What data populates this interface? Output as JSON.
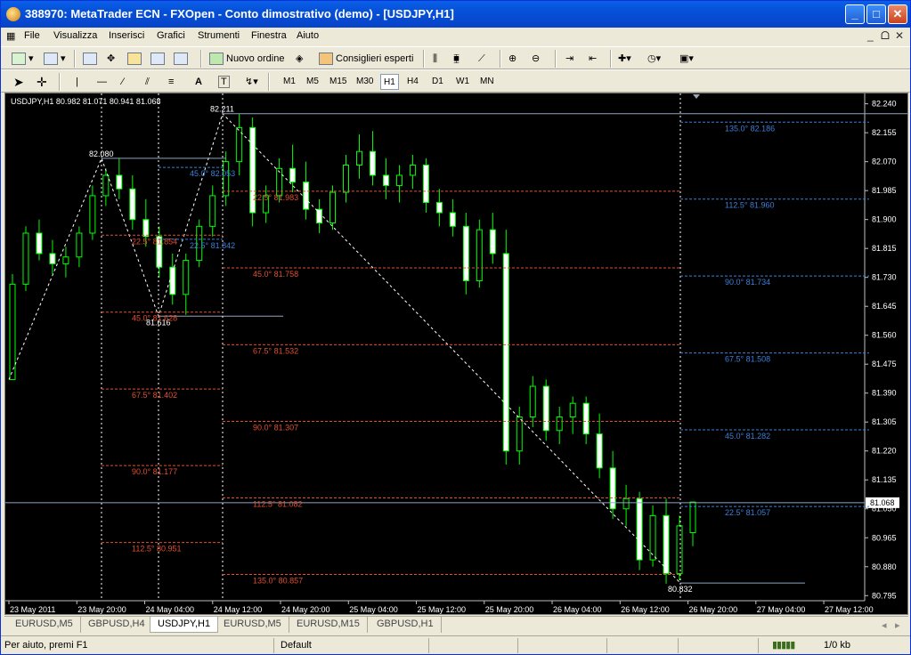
{
  "window": {
    "title": "388970: MetaTrader ECN - FXOpen - Conto dimostrativo (demo) - [USDJPY,H1]",
    "minimize": "_",
    "maximize": "□",
    "close": "✕"
  },
  "menu": [
    "File",
    "Visualizza",
    "Inserisci",
    "Grafici",
    "Strumenti",
    "Finestra",
    "Aiuto"
  ],
  "mdi": {
    "min": "_",
    "restore": "ᗝ",
    "close": "✕"
  },
  "toolbar1": {
    "new_order": "Nuovo ordine",
    "expert_advisors": "Consiglieri esperti"
  },
  "toolbar2": {
    "text_tool": "A",
    "label_tool": "T",
    "timeframes": [
      "M1",
      "M5",
      "M15",
      "M30",
      "H1",
      "H4",
      "D1",
      "W1",
      "MN"
    ],
    "active_timeframe": "H1"
  },
  "chart_data": {
    "type": "candlestick",
    "header": "USDJPY,H1  80.982 81.071 80.941 81.068",
    "price_scale": [
      "82.240",
      "82.155",
      "82.070",
      "81.985",
      "81.900",
      "81.815",
      "81.730",
      "81.645",
      "81.560",
      "81.475",
      "81.390",
      "81.305",
      "81.220",
      "81.135",
      "81.050",
      "80.965",
      "80.880",
      "80.795"
    ],
    "ylim": [
      80.78,
      82.26
    ],
    "current_price": "81.068",
    "time_labels": [
      "23 May 2011",
      "23 May 20:00",
      "24 May 04:00",
      "24 May 12:00",
      "24 May 20:00",
      "25 May 04:00",
      "25 May 12:00",
      "25 May 20:00",
      "26 May 04:00",
      "26 May 12:00",
      "26 May 20:00",
      "27 May 04:00",
      "27 May 12:00"
    ],
    "zigzag_points": [
      {
        "label": "82.080",
        "price": 82.08
      },
      {
        "label": "81.616",
        "price": 81.616
      },
      {
        "label": "82.211",
        "price": 82.211
      },
      {
        "label": "80.832",
        "price": 80.832
      }
    ],
    "gann_labels": [
      {
        "text": "45.0° 82.053",
        "price": 82.053,
        "color": "#3d7fd9"
      },
      {
        "text": "22.5° 81.842",
        "price": 81.842,
        "color": "#3d7fd9"
      },
      {
        "text": "22.5° 81.854",
        "price": 81.854,
        "color": "#e05030"
      },
      {
        "text": "45.0° 81.628",
        "price": 81.628,
        "color": "#e05030"
      },
      {
        "text": "67.5° 81.402",
        "price": 81.402,
        "color": "#e05030"
      },
      {
        "text": "90.0° 81.177",
        "price": 81.177,
        "color": "#e05030"
      },
      {
        "text": "112.5° 80.951",
        "price": 80.951,
        "color": "#e05030"
      },
      {
        "text": "22.5° 81.983",
        "price": 81.983,
        "color": "#e05030"
      },
      {
        "text": "45.0° 81.758",
        "price": 81.758,
        "color": "#e05030"
      },
      {
        "text": "67.5° 81.532",
        "price": 81.532,
        "color": "#e05030"
      },
      {
        "text": "90.0° 81.307",
        "price": 81.307,
        "color": "#e05030"
      },
      {
        "text": "112.5° 81.082",
        "price": 81.082,
        "color": "#e05030"
      },
      {
        "text": "135.0° 80.857",
        "price": 80.857,
        "color": "#e05030"
      },
      {
        "text": "135.0° 82.186",
        "price": 82.186,
        "color": "#3d7fd9"
      },
      {
        "text": "112.5° 81.960",
        "price": 81.96,
        "color": "#3d7fd9"
      },
      {
        "text": "90.0° 81.734",
        "price": 81.734,
        "color": "#3d7fd9"
      },
      {
        "text": "67.5° 81.508",
        "price": 81.508,
        "color": "#3d7fd9"
      },
      {
        "text": "45.0° 81.282",
        "price": 81.282,
        "color": "#3d7fd9"
      },
      {
        "text": "22.5° 81.057",
        "price": 81.057,
        "color": "#3d7fd9"
      }
    ],
    "candles": [
      [
        81.43,
        81.74,
        81.43,
        81.71
      ],
      [
        81.71,
        81.88,
        81.69,
        81.86
      ],
      [
        81.86,
        81.9,
        81.78,
        81.8
      ],
      [
        81.8,
        81.84,
        81.74,
        81.77
      ],
      [
        81.77,
        81.82,
        81.73,
        81.79
      ],
      [
        81.79,
        81.88,
        81.76,
        81.86
      ],
      [
        81.86,
        82.0,
        81.84,
        81.97
      ],
      [
        81.97,
        82.05,
        81.94,
        82.03
      ],
      [
        82.03,
        82.08,
        81.96,
        81.99
      ],
      [
        81.99,
        82.03,
        81.87,
        81.9
      ],
      [
        81.9,
        81.96,
        81.82,
        81.85
      ],
      [
        81.85,
        81.88,
        81.73,
        81.76
      ],
      [
        81.76,
        81.8,
        81.65,
        81.68
      ],
      [
        81.68,
        81.8,
        81.62,
        81.78
      ],
      [
        81.78,
        81.9,
        81.76,
        81.88
      ],
      [
        81.88,
        82.0,
        81.85,
        81.97
      ],
      [
        81.97,
        82.1,
        81.94,
        82.07
      ],
      [
        82.07,
        82.21,
        82.03,
        82.17
      ],
      [
        82.17,
        82.2,
        81.88,
        81.92
      ],
      [
        81.92,
        82.0,
        81.89,
        81.97
      ],
      [
        81.97,
        82.08,
        81.95,
        82.05
      ],
      [
        82.05,
        82.12,
        81.98,
        82.01
      ],
      [
        82.01,
        82.07,
        81.9,
        81.93
      ],
      [
        81.93,
        81.96,
        81.86,
        81.89
      ],
      [
        81.89,
        82.0,
        81.87,
        81.98
      ],
      [
        81.98,
        82.09,
        81.95,
        82.06
      ],
      [
        82.06,
        82.15,
        82.02,
        82.1
      ],
      [
        82.1,
        82.16,
        82.0,
        82.03
      ],
      [
        82.03,
        82.08,
        81.96,
        82.0
      ],
      [
        82.0,
        82.06,
        81.95,
        82.03
      ],
      [
        82.03,
        82.09,
        81.99,
        82.06
      ],
      [
        82.06,
        82.08,
        81.92,
        81.95
      ],
      [
        81.95,
        81.99,
        81.88,
        81.92
      ],
      [
        81.92,
        81.96,
        81.85,
        81.88
      ],
      [
        81.88,
        81.92,
        81.68,
        81.72
      ],
      [
        81.72,
        81.9,
        81.7,
        81.87
      ],
      [
        81.87,
        81.92,
        81.77,
        81.8
      ],
      [
        81.8,
        81.87,
        81.18,
        81.22
      ],
      [
        81.22,
        81.35,
        81.18,
        81.32
      ],
      [
        81.32,
        81.44,
        81.29,
        81.41
      ],
      [
        81.41,
        81.43,
        81.25,
        81.28
      ],
      [
        81.28,
        81.35,
        81.24,
        81.32
      ],
      [
        81.32,
        81.38,
        81.27,
        81.36
      ],
      [
        81.36,
        81.38,
        81.24,
        81.27
      ],
      [
        81.27,
        81.33,
        81.14,
        81.17
      ],
      [
        81.17,
        81.22,
        81.02,
        81.05
      ],
      [
        81.05,
        81.12,
        81.0,
        81.08
      ],
      [
        81.08,
        81.1,
        80.87,
        80.9
      ],
      [
        80.9,
        81.06,
        80.88,
        81.03
      ],
      [
        81.03,
        81.08,
        80.83,
        80.86
      ],
      [
        80.86,
        81.03,
        80.84,
        81.0
      ],
      [
        80.98,
        81.07,
        80.94,
        81.07
      ]
    ]
  },
  "tabs": [
    "EURUSD,M5",
    "GBPUSD,H4",
    "USDJPY,H1",
    "EURUSD,M5",
    "EURUSD,M15",
    "GBPUSD,H1"
  ],
  "active_tab": "USDJPY,H1",
  "tab_nav": {
    "left": "◂",
    "right": "▸"
  },
  "status": {
    "help": "Per aiuto, premi F1",
    "profile": "Default",
    "traffic": "1/0 kb"
  },
  "colors": {
    "bull": "#00ff00",
    "bear": "#00ff00",
    "grid": "#ffffff",
    "scale_text": "#ffffff"
  }
}
